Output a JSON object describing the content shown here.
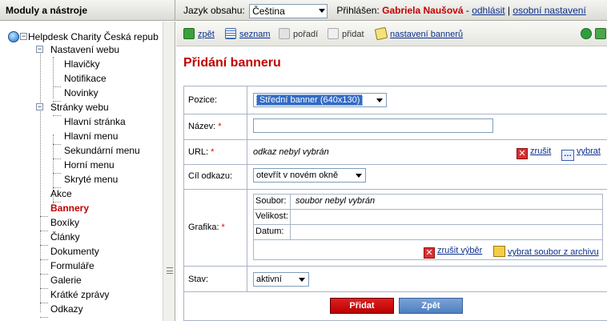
{
  "header": {
    "sidebar_title": "Moduly a nástroje",
    "lang_label": "Jazyk obsahu:",
    "lang_value": "Čeština",
    "logged_label": "Přihlášen:",
    "user_name": "Gabriela Naušová",
    "dash": "-",
    "logout": "odhlásit",
    "separator": "|",
    "settings": "osobní nastavení"
  },
  "sidebar": {
    "root": "Helpdesk Charity Česká repub",
    "items": [
      "Nastavení webu",
      "Hlavičky",
      "Notifikace",
      "Novinky",
      "Stránky webu",
      "Hlavní stránka",
      "Hlavní menu",
      "Sekundární menu",
      "Horní menu",
      "Skryté menu",
      "Akce",
      "Bannery",
      "Boxíky",
      "Články",
      "Dokumenty",
      "Formuláře",
      "Galerie",
      "Krátké zprávy",
      "Odkazy"
    ]
  },
  "toolbar": {
    "back": "zpět",
    "list": "seznam",
    "order": "pořadí",
    "add": "přidat",
    "banner_settings": "nastavení bannerů"
  },
  "page": {
    "title": "Přidání banneru"
  },
  "form": {
    "position_label": "Pozice:",
    "position_value": "Střední banner (640x130)",
    "name_label": "Název:",
    "name_value": "",
    "required_mark": "*",
    "url_label": "URL:",
    "url_value": "odkaz nebyl vybrán",
    "url_cancel": "zrušit",
    "url_choose": "vybrat",
    "target_label": "Cíl odkazu:",
    "target_value": "otevřít v novém okně",
    "graphics_label": "Grafika:",
    "file_label": "Soubor:",
    "file_value": "soubor nebyl vybrán",
    "size_label": "Velikost:",
    "date_label": "Datum:",
    "cancel_selection": "zrušit výběr",
    "choose_from_archive": "vybrat soubor z archivu",
    "status_label": "Stav:",
    "status_value": "aktivní",
    "submit": "Přidat",
    "back": "Zpět"
  }
}
